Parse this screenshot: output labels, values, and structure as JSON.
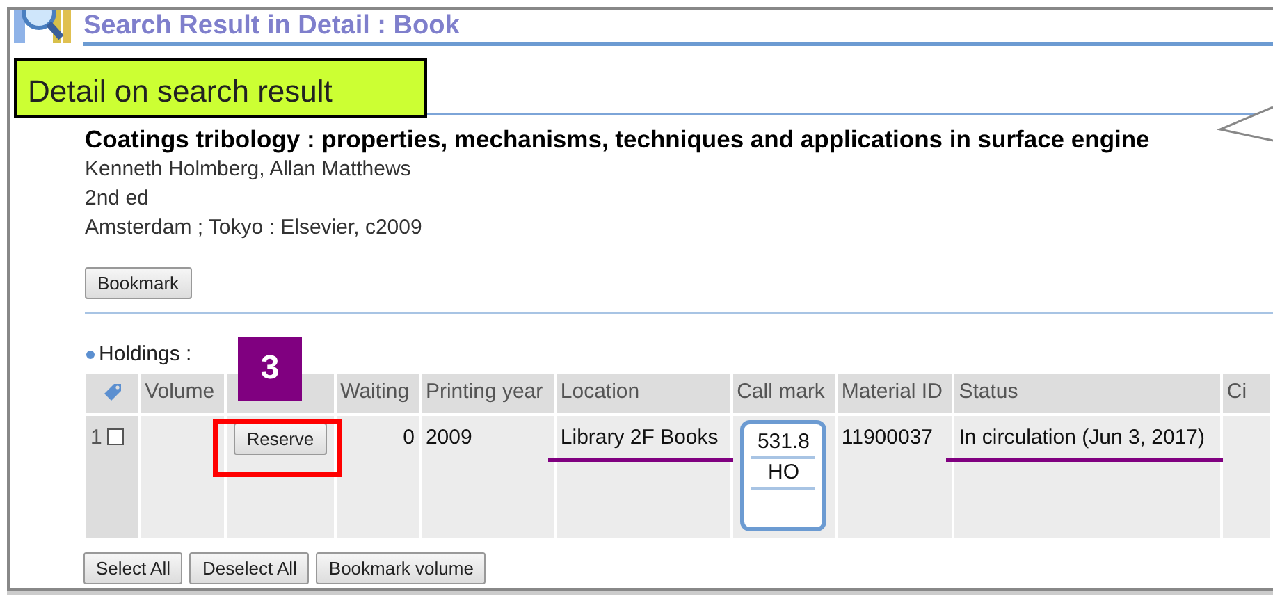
{
  "header": {
    "title": "Search Result in Detail : Book"
  },
  "callout": {
    "text": "Detail on search result"
  },
  "record": {
    "title": "Coatings tribology : properties, mechanisms, techniques and applications in surface engine",
    "lines": [
      "Kenneth Holmberg, Allan Matthews",
      "2nd ed",
      "Amsterdam ; Tokyo : Elsevier, c2009"
    ],
    "bookmark_button": "Bookmark"
  },
  "holdings": {
    "label": "Holdings :",
    "step_badge": "3",
    "columns": [
      {
        "kind": "icon"
      },
      {
        "kind": "text",
        "label": "Volume"
      },
      {
        "kind": "blank"
      },
      {
        "kind": "text",
        "label": "Waiting"
      },
      {
        "kind": "text",
        "label": "Printing year"
      },
      {
        "kind": "text",
        "label": "Location"
      },
      {
        "kind": "text",
        "label": "Call mark"
      },
      {
        "kind": "text",
        "label": "Material ID"
      },
      {
        "kind": "text",
        "label": "Status"
      },
      {
        "kind": "text",
        "label": "Ci"
      }
    ],
    "rows": [
      {
        "cells": [
          {
            "kind": "index",
            "text": "1",
            "checked": false
          },
          {
            "kind": "empty"
          },
          {
            "kind": "button",
            "text": "Reserve",
            "boxed": true
          },
          {
            "kind": "number",
            "text": "0"
          },
          {
            "kind": "text",
            "text": "2009"
          },
          {
            "kind": "text",
            "text": "Library 2F Books",
            "underlined": true
          },
          {
            "kind": "callmark",
            "lines": [
              "531.8",
              "HO"
            ]
          },
          {
            "kind": "text",
            "text": "11900037"
          },
          {
            "kind": "text",
            "text": "In circulation (Jun 3, 2017)",
            "underlined": true
          },
          {
            "kind": "empty"
          }
        ]
      }
    ],
    "buttons": [
      "Select All",
      "Deselect All",
      "Bookmark volume"
    ]
  }
}
